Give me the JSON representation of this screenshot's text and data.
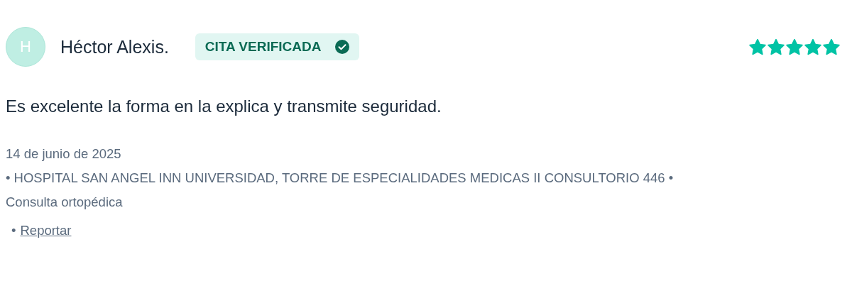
{
  "review": {
    "avatar_initial": "H",
    "author": "Héctor Alexis.",
    "badge": {
      "label": "CITA VERIFICADA",
      "verified": true
    },
    "stars": 5,
    "text": "Es excelente la forma en la explica y transmite seguridad.",
    "date": "14 de junio de 2025",
    "location": "• HOSPITAL SAN ANGEL INN UNIVERSIDAD, TORRE DE ESPECIALIDADES MEDICAS II CONSULTORIO 446 •",
    "service": "Consulta ortopédica",
    "report": {
      "bullet": "•",
      "link": "Reportar"
    }
  }
}
